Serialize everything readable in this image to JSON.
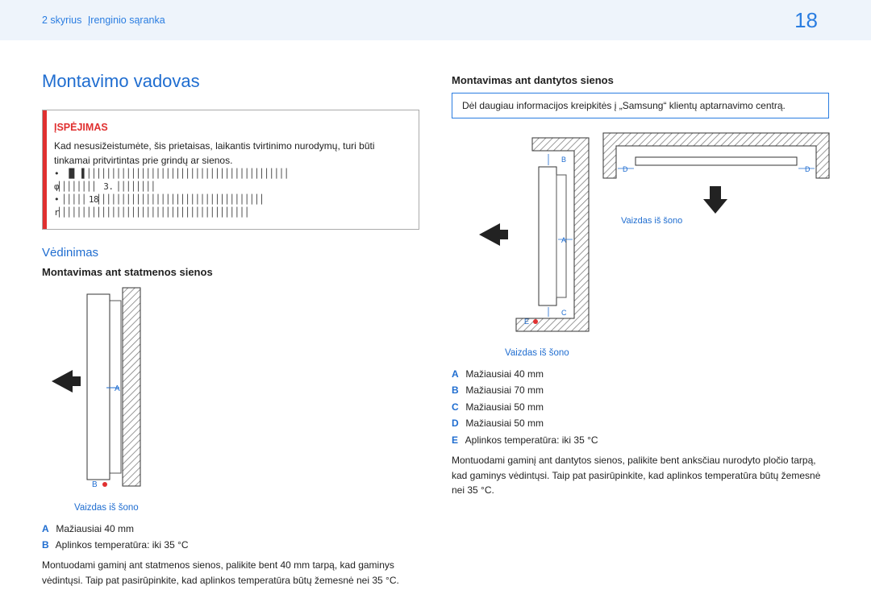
{
  "header": {
    "chapter": "2 skyrius",
    "section": "Įrenginio sąranka",
    "page_number": "18"
  },
  "left": {
    "title": "Montavimo vadovas",
    "warning": {
      "label": "ĮSPĖJIMAS",
      "line1": "Kad nesusižeistumėte, šis prietaisas, laikantis tvirtinimo nurodymų, turi būti tinkamai pritvirtintas prie grindų ar sienos.",
      "garble1": "•  █▏▐▏▏▏▏▏▏▏▏▏▏▏▏▏▏▏▏▏▏▏▏▏▏▏▏▏▏▏▏▏▏▏▏▏▏▏▏▏▏▏▏▏▏",
      "garble2": "  φ▏▏▏▏▏▏▏▏ 3. ▏▏▏▏▏▏▏▏",
      "garble3": "• ▏▏▏▏▏18▏▏▏▏▏▏▏▏▏▏▏▏▏▏▏▏▏▏▏▏▏▏▏▏▏▏▏▏▏▏▏▏▏▏",
      "garble4": "  r▏▏▏▏▏▏▏▏▏▏▏▏▏▏▏▏▏▏▏▏▏▏▏▏▏▏▏▏▏▏▏▏▏▏▏▏▏▏▏"
    },
    "ventilation_heading": "Vėdinimas",
    "perp_heading": "Montavimas ant statmenos sienos",
    "fig_caption": "Vaizdas iš šono",
    "fig_labels": {
      "A": "A",
      "B": "B"
    },
    "specs": [
      {
        "id": "A",
        "text": "Mažiausiai 40 mm"
      },
      {
        "id": "B",
        "text": "Aplinkos temperatūra: iki 35 °C"
      }
    ],
    "body1": "Montuodami gaminį ant statmenos sienos, palikite bent 40 mm tarpą, kad gaminys vėdintųsi. Taip pat pasirūpinkite, kad aplinkos temperatūra būtų žemesnė nei 35 °C."
  },
  "right": {
    "heading": "Montavimas ant dantytos sienos",
    "info": "Dėl daugiau informacijos kreipkitės į „Samsung“ klientų aptarnavimo centrą.",
    "caption_side": "Vaizdas iš šono",
    "caption_top": "Vaizdas iš šono",
    "fig_labels": {
      "A": "A",
      "B": "B",
      "C": "C",
      "D": "D",
      "E": "E"
    },
    "specs": [
      {
        "id": "A",
        "text": "Mažiausiai 40 mm"
      },
      {
        "id": "B",
        "text": "Mažiausiai 70 mm"
      },
      {
        "id": "C",
        "text": "Mažiausiai 50 mm"
      },
      {
        "id": "D",
        "text": "Mažiausiai 50 mm"
      },
      {
        "id": "E",
        "text": "Aplinkos temperatūra: iki 35 °C"
      }
    ],
    "body1": "Montuodami gaminį ant dantytos sienos, palikite bent anksčiau nurodyto pločio tarpą, kad gaminys vėdintųsi. Taip pat pasirūpinkite, kad aplinkos temperatūra būtų žemesnė nei 35 °C."
  }
}
